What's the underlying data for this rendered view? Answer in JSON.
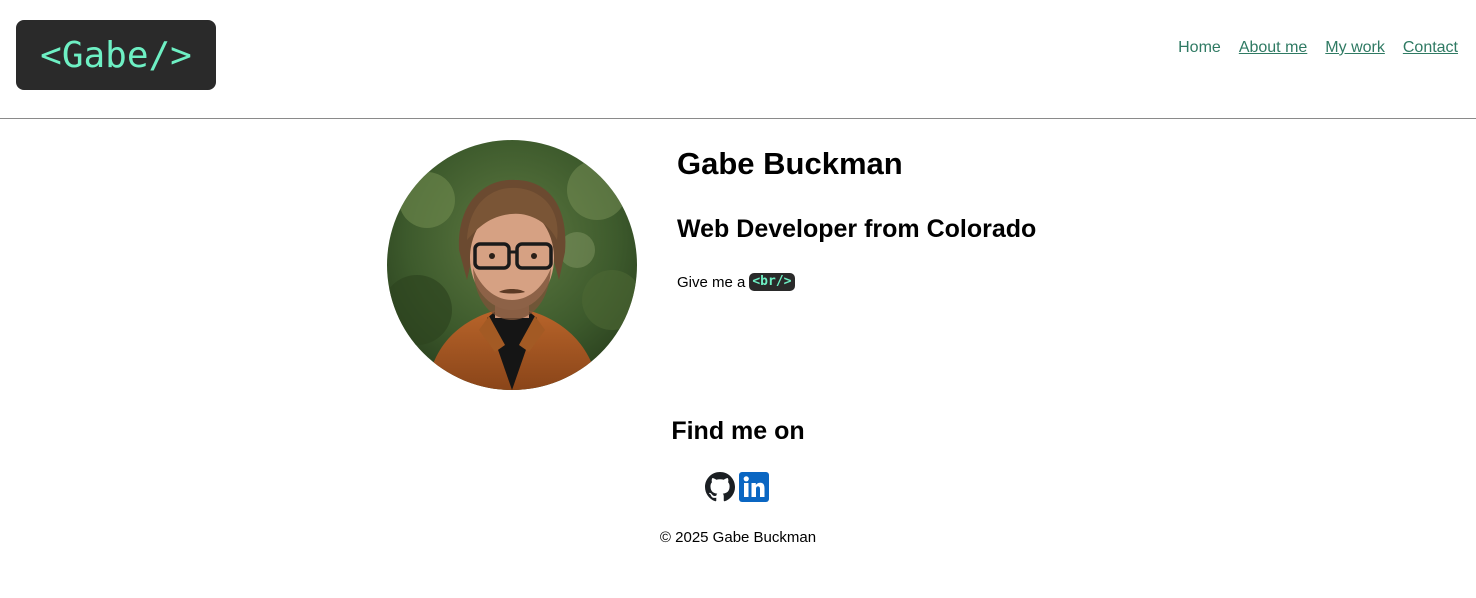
{
  "header": {
    "logo_text": "<Gabe/>",
    "nav": [
      {
        "label": "Home"
      },
      {
        "label": "About me"
      },
      {
        "label": "My work"
      },
      {
        "label": "Contact"
      }
    ]
  },
  "profile": {
    "name": "Gabe Buckman",
    "subtitle": "Web Developer from Colorado",
    "tagline_prefix": "Give me a",
    "tagline_code": "<br/>"
  },
  "social": {
    "heading": "Find me on",
    "icons": [
      "github-icon",
      "linkedin-icon"
    ]
  },
  "footer": {
    "copyright": "© 2025 Gabe Buckman"
  },
  "colors": {
    "accent": "#6ef0c4",
    "link": "#2f7a63",
    "dark": "#2a2a2a",
    "linkedin": "#0a66c2"
  }
}
